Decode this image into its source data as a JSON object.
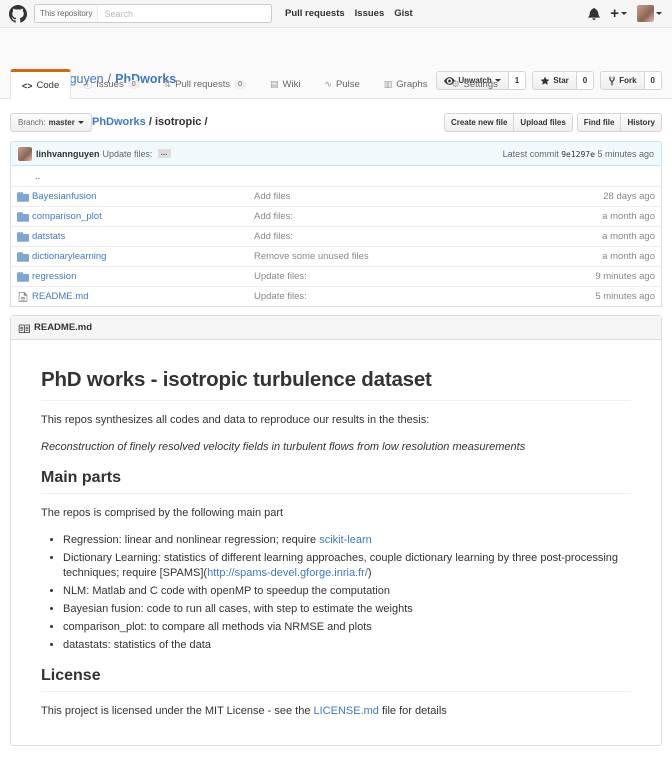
{
  "header": {
    "scope_label": "This repository",
    "search_placeholder": "Search",
    "nav": [
      "Pull requests",
      "Issues",
      "Gist"
    ],
    "plus": "+"
  },
  "repo": {
    "owner": "linhvannguyen",
    "separator": "/",
    "name": "PhDworks",
    "watch_label": "Unwatch",
    "watch_count": "1",
    "star_label": "Star",
    "star_count": "0",
    "fork_label": "Fork",
    "fork_count": "0"
  },
  "tabs": [
    {
      "icon": "<>",
      "label": "Code",
      "badge": ""
    },
    {
      "icon": "ⓘ",
      "label": "Issues",
      "badge": "0"
    },
    {
      "icon": "⇅",
      "label": "Pull requests",
      "badge": "0"
    },
    {
      "icon": "▤",
      "label": "Wiki",
      "badge": ""
    },
    {
      "icon": "∿",
      "label": "Pulse",
      "badge": ""
    },
    {
      "icon": "▥",
      "label": "Graphs",
      "badge": ""
    },
    {
      "icon": "⚙",
      "label": "Settings",
      "badge": ""
    }
  ],
  "filenav": {
    "branch_label": "Branch:",
    "branch_value": "master",
    "crumb_repo": "PhDworks",
    "crumb_sep": " / ",
    "crumb_path": "isotropic",
    "crumb_tail": " /",
    "create_file": "Create new file",
    "upload_files": "Upload files",
    "find_file": "Find file",
    "history": "History"
  },
  "commit": {
    "author": "linhvannguyen",
    "message": "Update files:",
    "ellipsis": "…",
    "latest_label": "Latest commit",
    "sha": "9e1297e",
    "age": "5 minutes ago"
  },
  "files": {
    "updir": "..",
    "rows": [
      {
        "type": "dir",
        "name": "Bayesianfusion",
        "message": "Add files",
        "age": "28 days ago"
      },
      {
        "type": "dir",
        "name": "comparison_plot",
        "message": "Add files:",
        "age": "a month ago"
      },
      {
        "type": "dir",
        "name": "datstats",
        "message": "Add files:",
        "age": "a month ago"
      },
      {
        "type": "dir",
        "name": "dictionarylearning",
        "message": "Remove some unused files",
        "age": "a month ago"
      },
      {
        "type": "dir",
        "name": "regression",
        "message": "Update files:",
        "age": "9 minutes ago"
      },
      {
        "type": "file",
        "name": "README.md",
        "message": "Update files:",
        "age": "5 minutes ago"
      }
    ]
  },
  "readme": {
    "filename": "README.md",
    "h1": "PhD works - isotropic turbulence dataset",
    "intro": "This repos synthesizes all codes and data to reproduce our results in the thesis:",
    "thesis": "Reconstruction of finely resolved velocity fields in turbulent flows from low resolution measurements",
    "h2_main": "Main parts",
    "main_intro": "The repos is comprised by the following main part",
    "li_regression": "Regression: linear and nonlinear regression; require ",
    "li_regression_link": "scikit-learn",
    "li_dict": "Dictionary Learning: statistics of different learning approaches, couple dictionary learning by three post-processing techniques; require [SPAMS](",
    "li_dict_link": "http://spams-devel.gforge.inria.fr/",
    "li_dict_tail": ")",
    "li_nlm": "NLM: Matlab and C code with openMP to speedup the computation",
    "li_bayes": "Bayesian fusion: code to run all cases, with step to estimate the weights",
    "li_comp": "comparison_plot: to compare all methods via NRMSE and plots",
    "li_datstats": "datastats: statistics of the data",
    "h2_license": "License",
    "license_pre": "This project is licensed under the MIT License - see the ",
    "license_link": "LICENSE.md",
    "license_post": " file for details"
  },
  "colors": {
    "link": "#4078c0",
    "tab_accent": "#d26911",
    "commit_bg": "#f2f9fc",
    "folder": "#80a6cd"
  }
}
